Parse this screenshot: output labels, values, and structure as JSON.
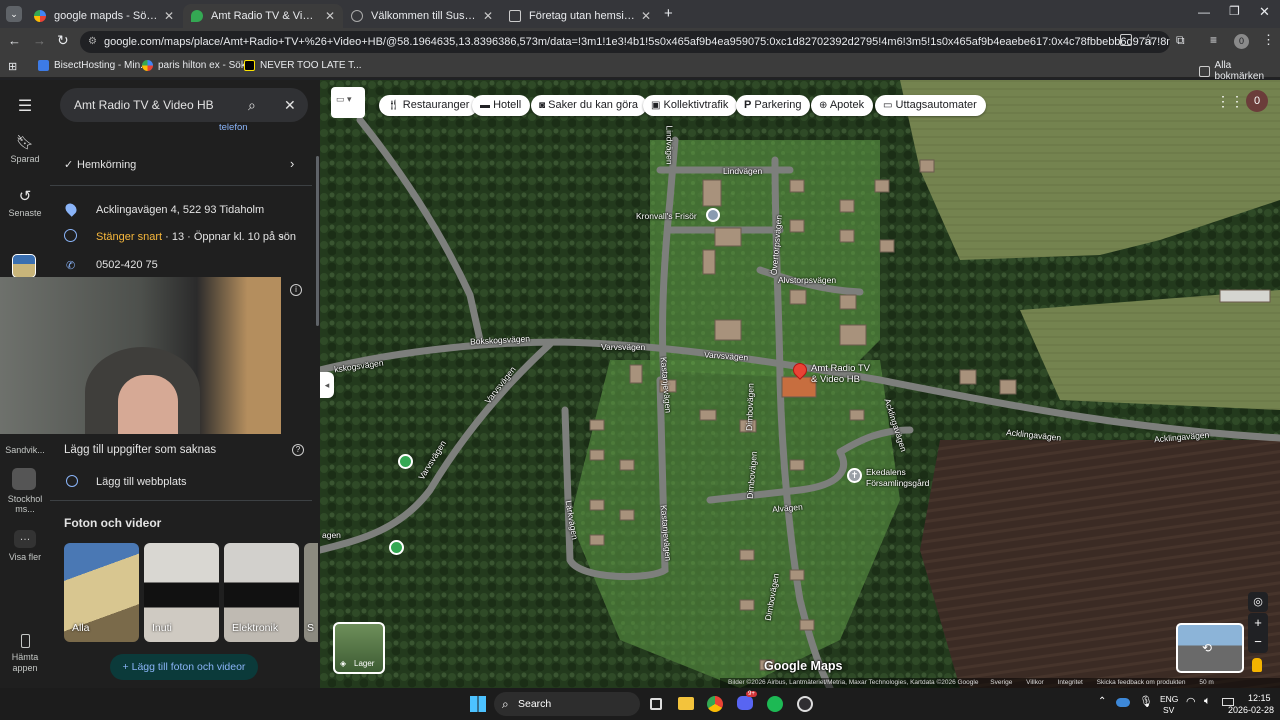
{
  "browser": {
    "tabs": [
      {
        "label": "google mapds - Sök på Google",
        "active": false
      },
      {
        "label": "Amt Radio TV & Video HB – Go",
        "active": true
      },
      {
        "label": "Välkommen till Sushitai Restau",
        "active": false
      },
      {
        "label": "Företag utan hemsida Uppsala",
        "active": false
      }
    ],
    "url": "google.com/maps/place/Amt+Radio+TV+%26+Video+HB/@58.1964635,13.8396386,573m/data=!3m1!1e3!4b1!5s0x465af9b4ea959075:0xc1d82702392d2795!4m6!3m5!1s0x465af9b4eaebe617:0x4c78fbbebb6d97a7!8m2!3d58.1964607!4d13.84...",
    "profile_initial": "0",
    "bookmarks": [
      "BisectHosting - Min...",
      "paris hilton ex - Sök...",
      "NEVER TOO LATE T..."
    ],
    "all_bookmarks": "Alla bokmärken"
  },
  "rail": {
    "saved": "Sparad",
    "recent": "Senaste",
    "item1": "Sandvik...",
    "item2": "Stockholms...",
    "more": "Visa fler",
    "app": "Hämta appen"
  },
  "place": {
    "search": "Amt Radio TV & Video HB",
    "phone_link": "telefon",
    "delivery": "Hemkörning",
    "address": "Acklingavägen 4, 522 93 Tidaholm",
    "hours_status": "Stänger snart",
    "hours_detail": " · 13 · Öppnar kl. 10 på sön",
    "phone": "0502-420 75",
    "add_missing": "Lägg till uppgifter som saknas",
    "add_website": "Lägg till webbplats",
    "photos_title": "Foton och videor",
    "photos": [
      "Alla",
      "Inuti",
      "Elektronik",
      "S"
    ],
    "add_photos": "Lägg till foton och videor"
  },
  "map": {
    "chips": [
      "Restauranger",
      "Hotell",
      "Saker du kan göra",
      "Kollektivtrafik",
      "Parkering",
      "Apotek",
      "Uttagsautomater"
    ],
    "apps_badge": "0",
    "labels": {
      "lindvagen": "Lindvägen",
      "overtorp": "Övertorpsvägen",
      "alvstorp": "Alvstorpsvägen",
      "kronvall": "Kronvall's Frisör",
      "bokskog": "Bokskogsvägen",
      "bokskog2": "kskogsvägen",
      "varvs1": "Varvsvägen",
      "varvs2": "Varvsvägen",
      "varvs3": "Varvsvägen",
      "varvs4": "Varvsvägen",
      "varvs5": "agen",
      "place_line1": "Amt Radio TV",
      "place_line2": "& Video HB",
      "ackling1": "Acklingavägen",
      "ackling2": "Acklingavägen",
      "ackling3": "Acklingavägen",
      "kastanj": "Kastanjevägen",
      "kastanj2": "Kastanjevägen",
      "dimbo1": "Dimbovägen",
      "dimbo2": "Dimbovägen",
      "dimbo3": "Dimbovägen",
      "alvagen": "Alvägen",
      "larkvagen": "Lärkvägen",
      "ekedal1": "Ekedalens",
      "ekedal2": "Församlingsgård",
      "lindvagen2": "Lindvägen"
    },
    "layers": "Lager",
    "brand": "Google Maps",
    "attribution": "Bilder ©2026 Airbus, Lantmäteriet/Metria, Maxar Technologies, Kartdata ©2026 Google",
    "footer_links": [
      "Sverige",
      "Villkor",
      "Integritet",
      "Skicka feedback om produkten"
    ],
    "scale": "50 m"
  },
  "taskbar": {
    "search": "Search",
    "lang1": "ENG",
    "lang2": "SV",
    "time": "12:15",
    "date": "2026-02-28",
    "badge": "9+"
  }
}
